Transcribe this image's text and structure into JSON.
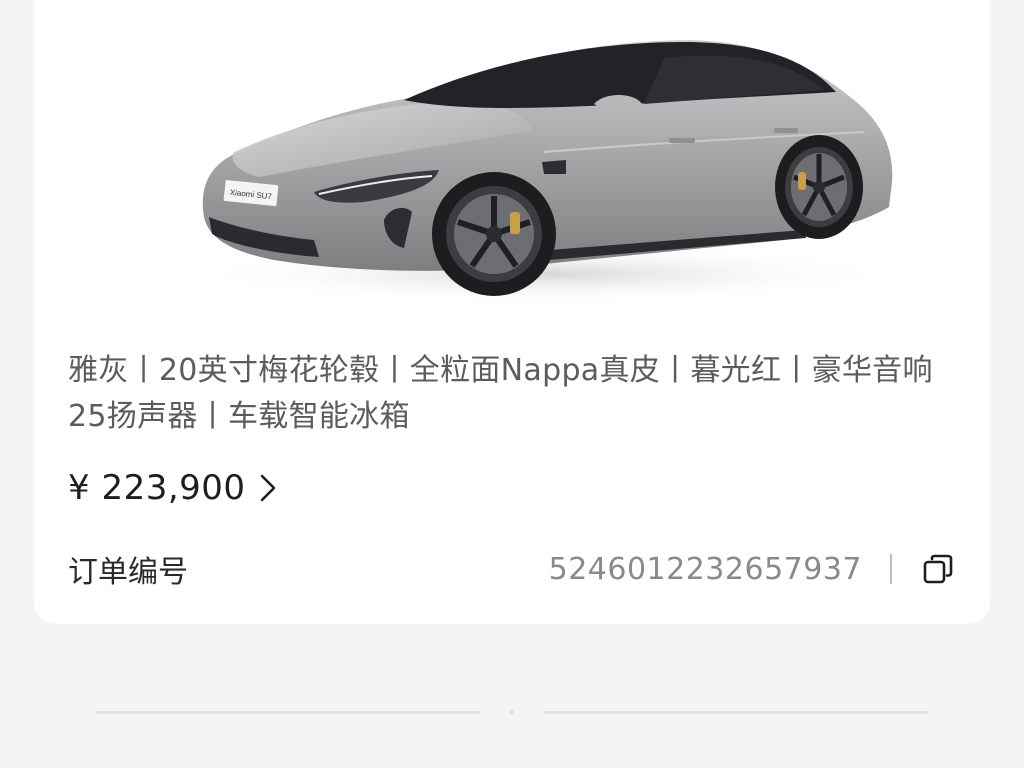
{
  "product": {
    "image_alt": "Xiaomi SU7 gray sedan",
    "plate_text": "Xiaomi SU7",
    "specs": "雅灰丨20英寸梅花轮毂丨全粒面Nappa真皮丨暮光红丨豪华音响 25扬声器丨车载智能冰箱",
    "price": "¥ 223,900"
  },
  "order": {
    "label": "订单编号",
    "number": "5246012232657937"
  },
  "icons": {
    "price_chevron": "chevron-right-icon",
    "copy": "copy-icon"
  },
  "colors": {
    "background": "#f4f4f4",
    "card": "#ffffff",
    "car_body": "#a7a8aa",
    "brake_caliper": "#c9a04a"
  }
}
